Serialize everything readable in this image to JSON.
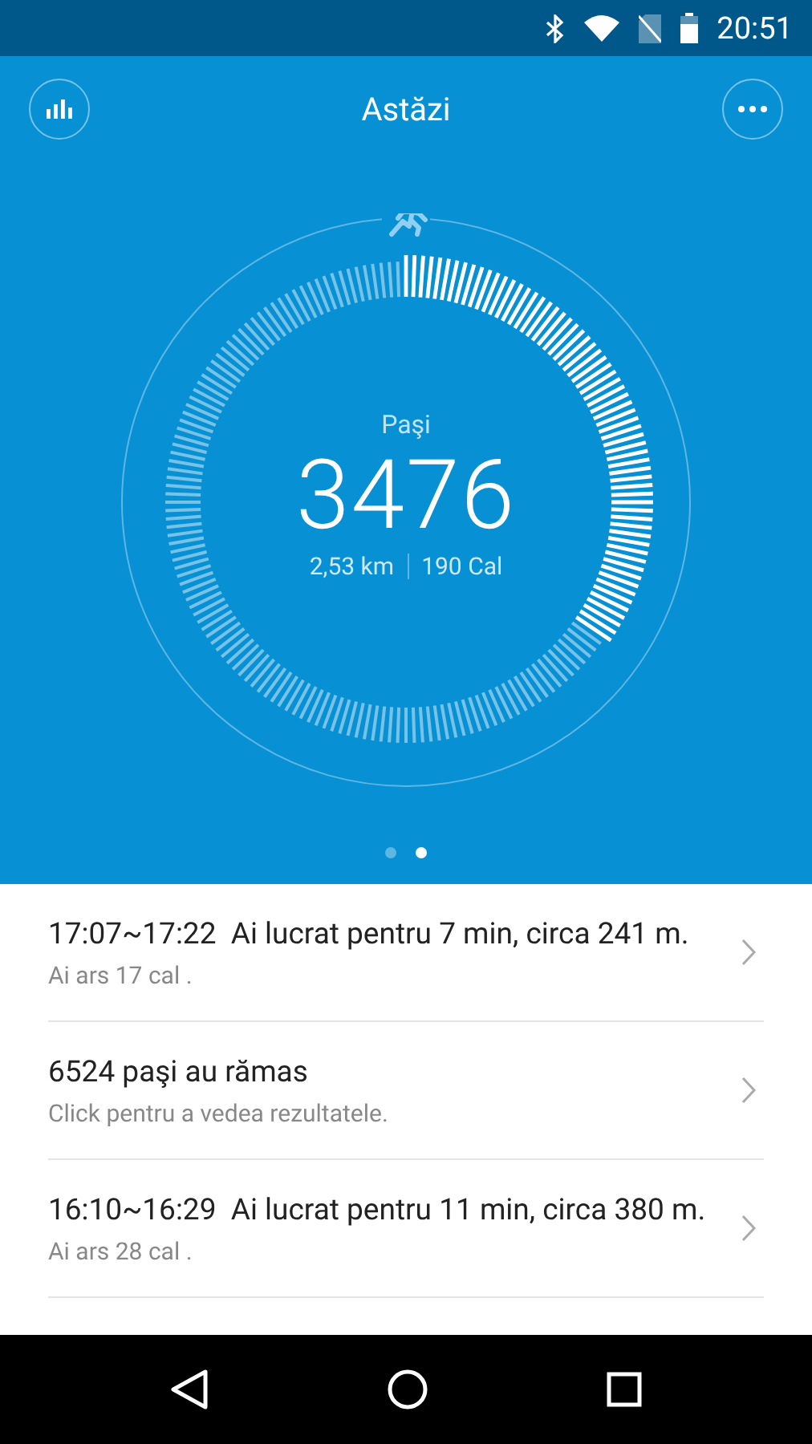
{
  "status_bar": {
    "time": "20:51"
  },
  "header": {
    "title": "Astăzi"
  },
  "summary": {
    "label": "Paşi",
    "steps": "3476",
    "distance": "2,53 km",
    "calories": "190 Cal"
  },
  "pages": [
    {
      "selected": false
    },
    {
      "selected": true
    }
  ],
  "events": [
    {
      "title": "17:07~17:22  Ai lucrat pentru 7 min, circa 241 m.",
      "subtitle": "Ai ars 17 cal ."
    },
    {
      "title": "6524 paşi au rămas",
      "subtitle": "Click pentru a vedea rezultatele."
    },
    {
      "title": "16:10~16:29  Ai lucrat pentru 11 min, circa 380 m.",
      "subtitle": "Ai ars 28 cal ."
    }
  ]
}
